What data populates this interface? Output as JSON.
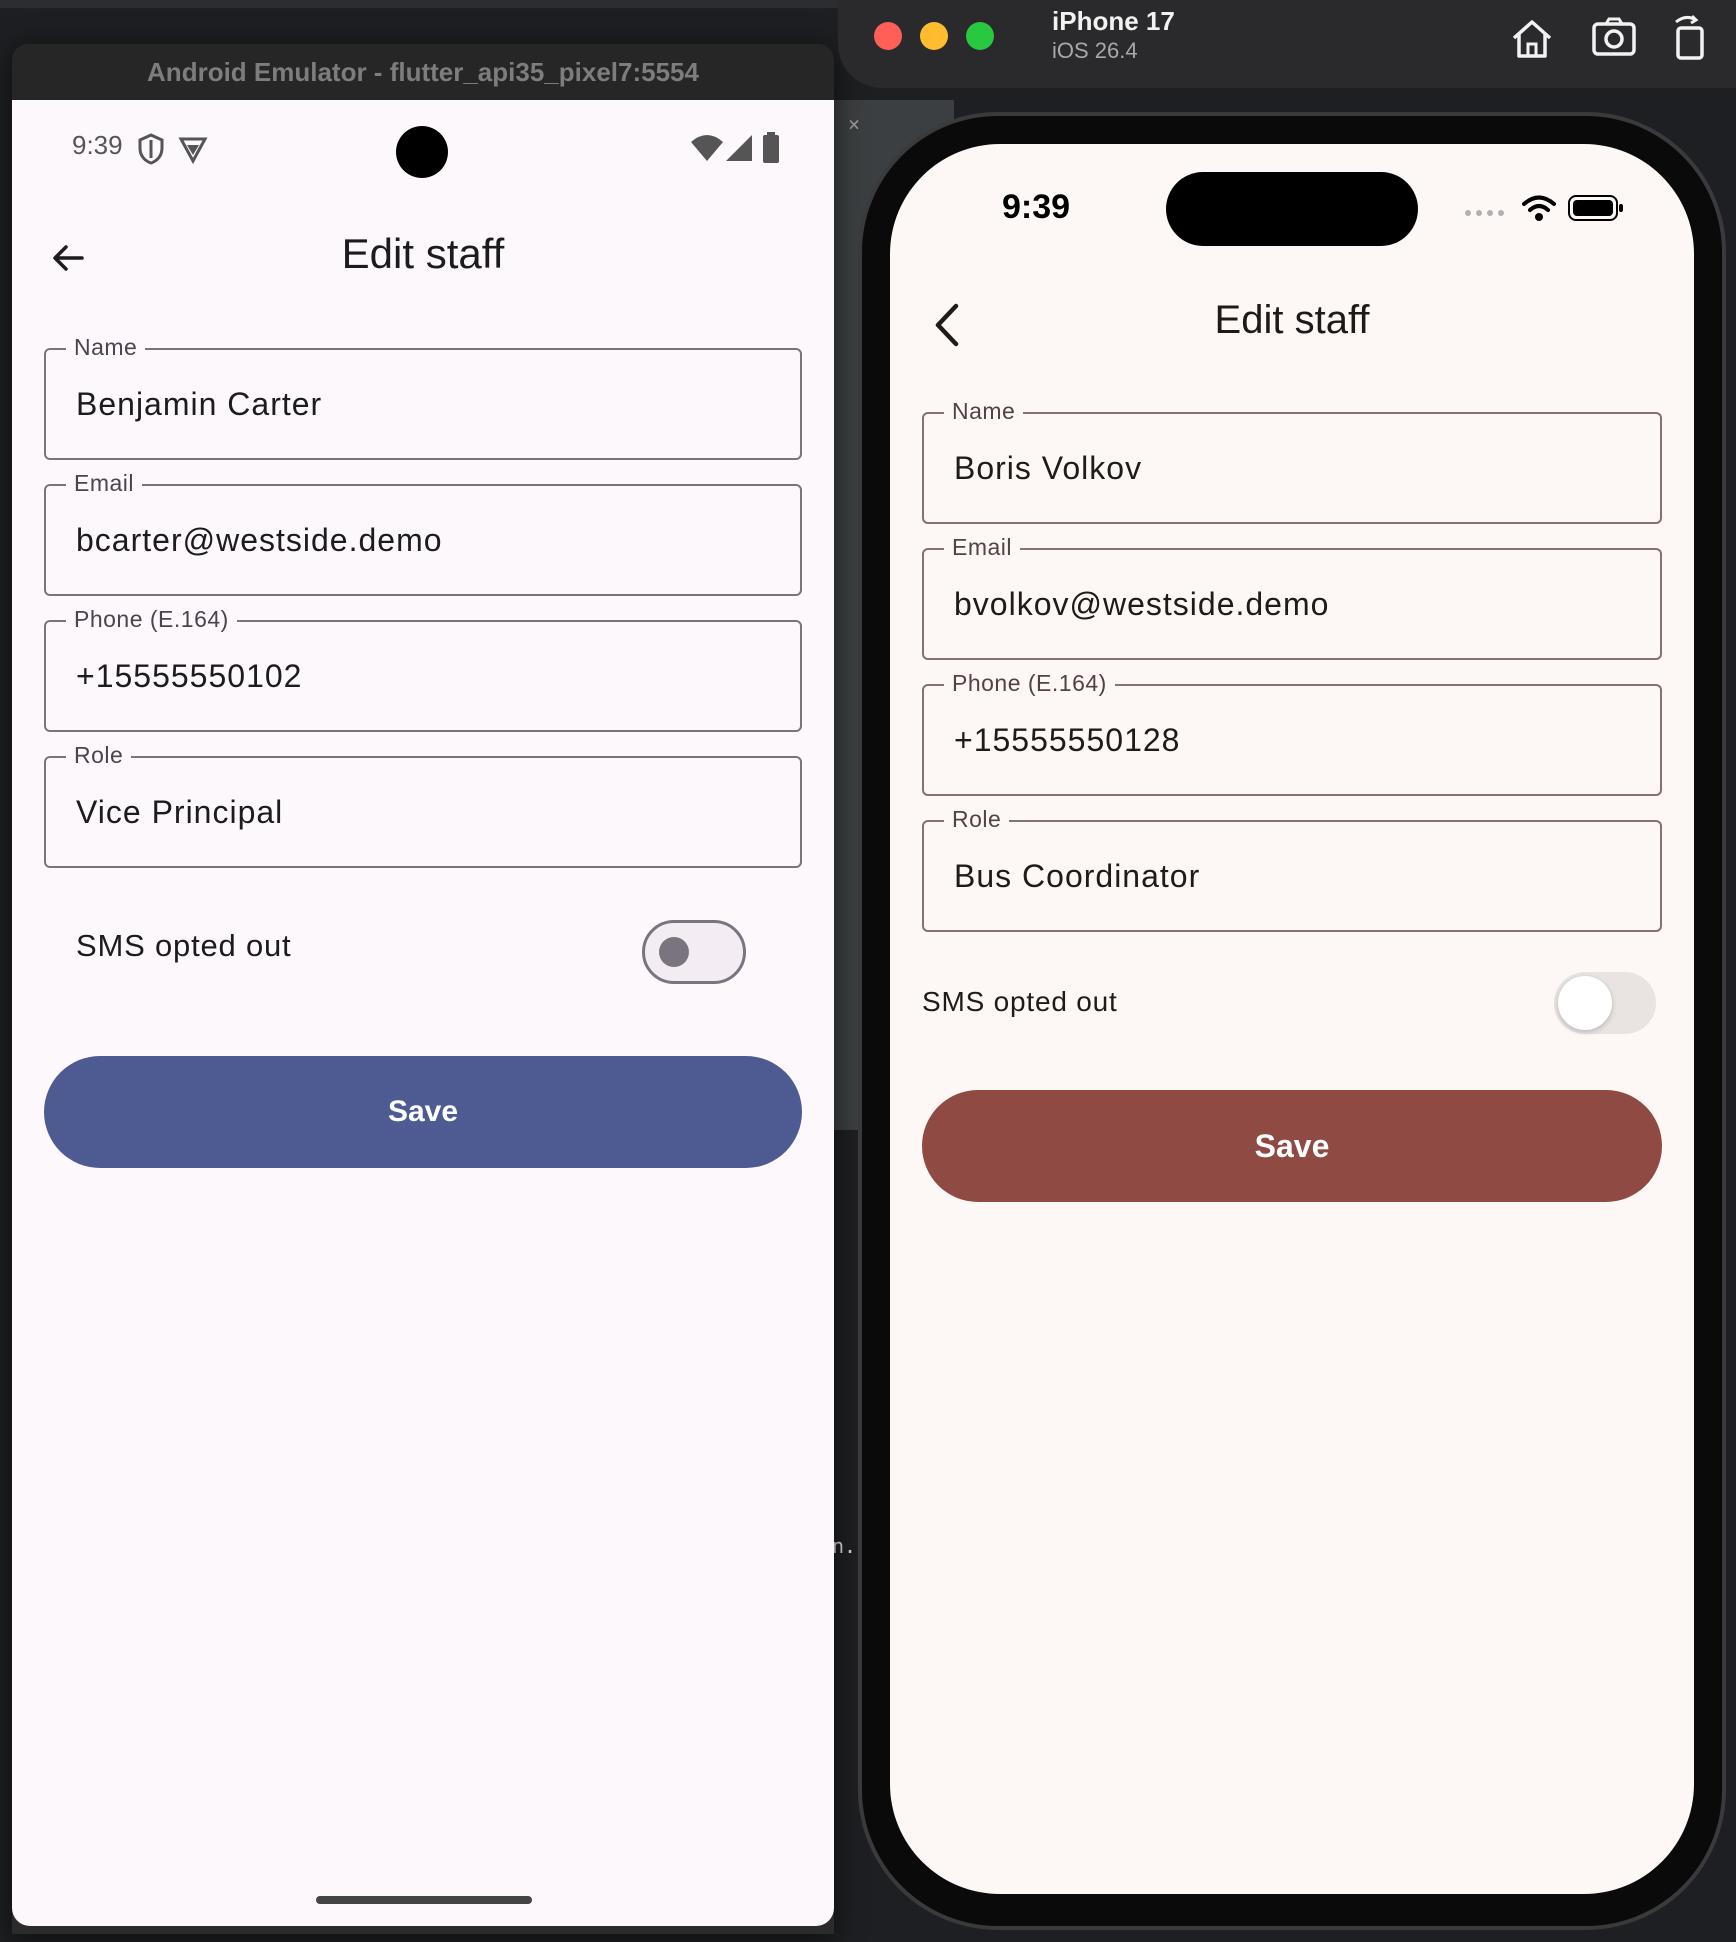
{
  "android": {
    "window_title": "Android Emulator - flutter_api35_pixel7:5554",
    "status_time": "9:39",
    "page_title": "Edit staff",
    "fields": [
      {
        "label": "Name",
        "value": "Benjamin Carter"
      },
      {
        "label": "Email",
        "value": "bcarter@westside.demo"
      },
      {
        "label": "Phone (E.164)",
        "value": "+15555550102"
      },
      {
        "label": "Role",
        "value": "Vice Principal"
      }
    ],
    "sms_label": "SMS opted out",
    "sms_opted_out": false,
    "save_label": "Save",
    "accent_color": "#4e5b92"
  },
  "ios": {
    "device_name": "iPhone 17",
    "os_version": "iOS 26.4",
    "status_time": "9:39",
    "page_title": "Edit staff",
    "fields": [
      {
        "label": "Name",
        "value": "Boris Volkov"
      },
      {
        "label": "Email",
        "value": "bvolkov@westside.demo"
      },
      {
        "label": "Phone (E.164)",
        "value": "+15555550128"
      },
      {
        "label": "Role",
        "value": "Bus Coordinator"
      }
    ],
    "sms_label": "SMS opted out",
    "sms_opted_out": false,
    "save_label": "Save",
    "accent_color": "#904a44"
  },
  "toolbar_icons": [
    "home-icon",
    "screenshot-icon",
    "rotate-icon"
  ]
}
